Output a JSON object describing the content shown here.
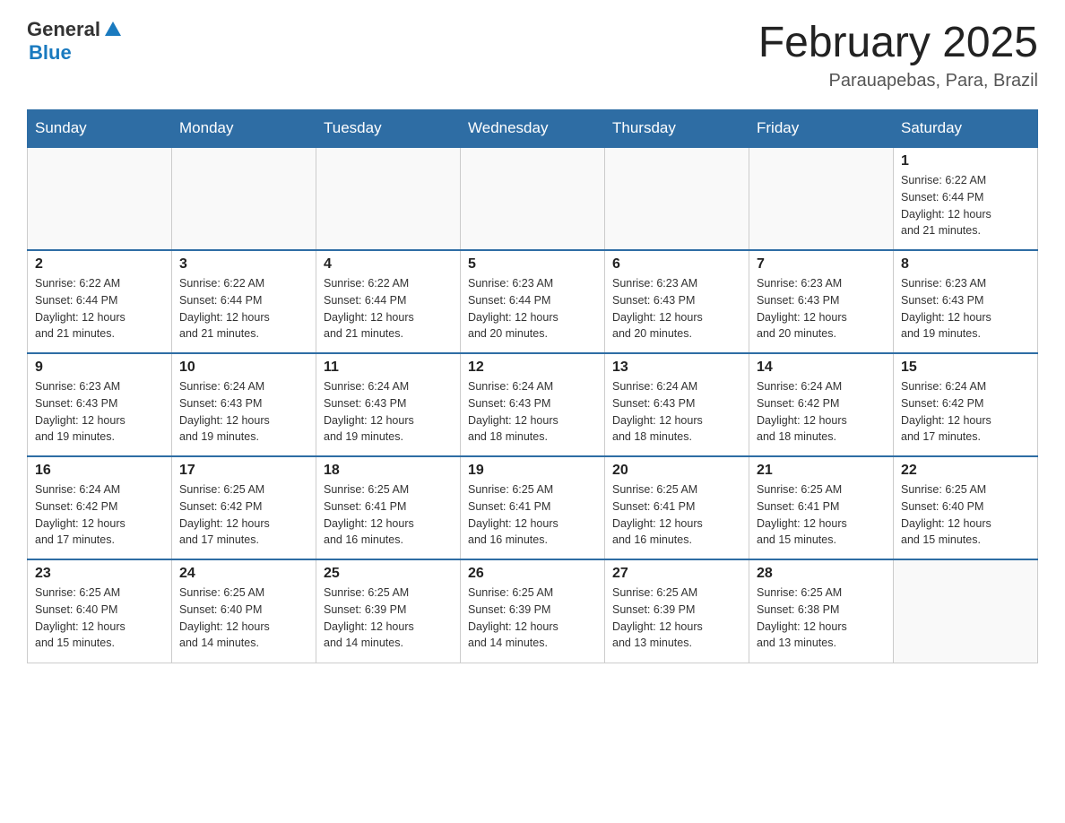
{
  "header": {
    "logo_general": "General",
    "logo_blue": "Blue",
    "month_title": "February 2025",
    "location": "Parauapebas, Para, Brazil"
  },
  "weekdays": [
    "Sunday",
    "Monday",
    "Tuesday",
    "Wednesday",
    "Thursday",
    "Friday",
    "Saturday"
  ],
  "weeks": [
    [
      {
        "day": "",
        "info": ""
      },
      {
        "day": "",
        "info": ""
      },
      {
        "day": "",
        "info": ""
      },
      {
        "day": "",
        "info": ""
      },
      {
        "day": "",
        "info": ""
      },
      {
        "day": "",
        "info": ""
      },
      {
        "day": "1",
        "info": "Sunrise: 6:22 AM\nSunset: 6:44 PM\nDaylight: 12 hours\nand 21 minutes."
      }
    ],
    [
      {
        "day": "2",
        "info": "Sunrise: 6:22 AM\nSunset: 6:44 PM\nDaylight: 12 hours\nand 21 minutes."
      },
      {
        "day": "3",
        "info": "Sunrise: 6:22 AM\nSunset: 6:44 PM\nDaylight: 12 hours\nand 21 minutes."
      },
      {
        "day": "4",
        "info": "Sunrise: 6:22 AM\nSunset: 6:44 PM\nDaylight: 12 hours\nand 21 minutes."
      },
      {
        "day": "5",
        "info": "Sunrise: 6:23 AM\nSunset: 6:44 PM\nDaylight: 12 hours\nand 20 minutes."
      },
      {
        "day": "6",
        "info": "Sunrise: 6:23 AM\nSunset: 6:43 PM\nDaylight: 12 hours\nand 20 minutes."
      },
      {
        "day": "7",
        "info": "Sunrise: 6:23 AM\nSunset: 6:43 PM\nDaylight: 12 hours\nand 20 minutes."
      },
      {
        "day": "8",
        "info": "Sunrise: 6:23 AM\nSunset: 6:43 PM\nDaylight: 12 hours\nand 19 minutes."
      }
    ],
    [
      {
        "day": "9",
        "info": "Sunrise: 6:23 AM\nSunset: 6:43 PM\nDaylight: 12 hours\nand 19 minutes."
      },
      {
        "day": "10",
        "info": "Sunrise: 6:24 AM\nSunset: 6:43 PM\nDaylight: 12 hours\nand 19 minutes."
      },
      {
        "day": "11",
        "info": "Sunrise: 6:24 AM\nSunset: 6:43 PM\nDaylight: 12 hours\nand 19 minutes."
      },
      {
        "day": "12",
        "info": "Sunrise: 6:24 AM\nSunset: 6:43 PM\nDaylight: 12 hours\nand 18 minutes."
      },
      {
        "day": "13",
        "info": "Sunrise: 6:24 AM\nSunset: 6:43 PM\nDaylight: 12 hours\nand 18 minutes."
      },
      {
        "day": "14",
        "info": "Sunrise: 6:24 AM\nSunset: 6:42 PM\nDaylight: 12 hours\nand 18 minutes."
      },
      {
        "day": "15",
        "info": "Sunrise: 6:24 AM\nSunset: 6:42 PM\nDaylight: 12 hours\nand 17 minutes."
      }
    ],
    [
      {
        "day": "16",
        "info": "Sunrise: 6:24 AM\nSunset: 6:42 PM\nDaylight: 12 hours\nand 17 minutes."
      },
      {
        "day": "17",
        "info": "Sunrise: 6:25 AM\nSunset: 6:42 PM\nDaylight: 12 hours\nand 17 minutes."
      },
      {
        "day": "18",
        "info": "Sunrise: 6:25 AM\nSunset: 6:41 PM\nDaylight: 12 hours\nand 16 minutes."
      },
      {
        "day": "19",
        "info": "Sunrise: 6:25 AM\nSunset: 6:41 PM\nDaylight: 12 hours\nand 16 minutes."
      },
      {
        "day": "20",
        "info": "Sunrise: 6:25 AM\nSunset: 6:41 PM\nDaylight: 12 hours\nand 16 minutes."
      },
      {
        "day": "21",
        "info": "Sunrise: 6:25 AM\nSunset: 6:41 PM\nDaylight: 12 hours\nand 15 minutes."
      },
      {
        "day": "22",
        "info": "Sunrise: 6:25 AM\nSunset: 6:40 PM\nDaylight: 12 hours\nand 15 minutes."
      }
    ],
    [
      {
        "day": "23",
        "info": "Sunrise: 6:25 AM\nSunset: 6:40 PM\nDaylight: 12 hours\nand 15 minutes."
      },
      {
        "day": "24",
        "info": "Sunrise: 6:25 AM\nSunset: 6:40 PM\nDaylight: 12 hours\nand 14 minutes."
      },
      {
        "day": "25",
        "info": "Sunrise: 6:25 AM\nSunset: 6:39 PM\nDaylight: 12 hours\nand 14 minutes."
      },
      {
        "day": "26",
        "info": "Sunrise: 6:25 AM\nSunset: 6:39 PM\nDaylight: 12 hours\nand 14 minutes."
      },
      {
        "day": "27",
        "info": "Sunrise: 6:25 AM\nSunset: 6:39 PM\nDaylight: 12 hours\nand 13 minutes."
      },
      {
        "day": "28",
        "info": "Sunrise: 6:25 AM\nSunset: 6:38 PM\nDaylight: 12 hours\nand 13 minutes."
      },
      {
        "day": "",
        "info": ""
      }
    ]
  ]
}
